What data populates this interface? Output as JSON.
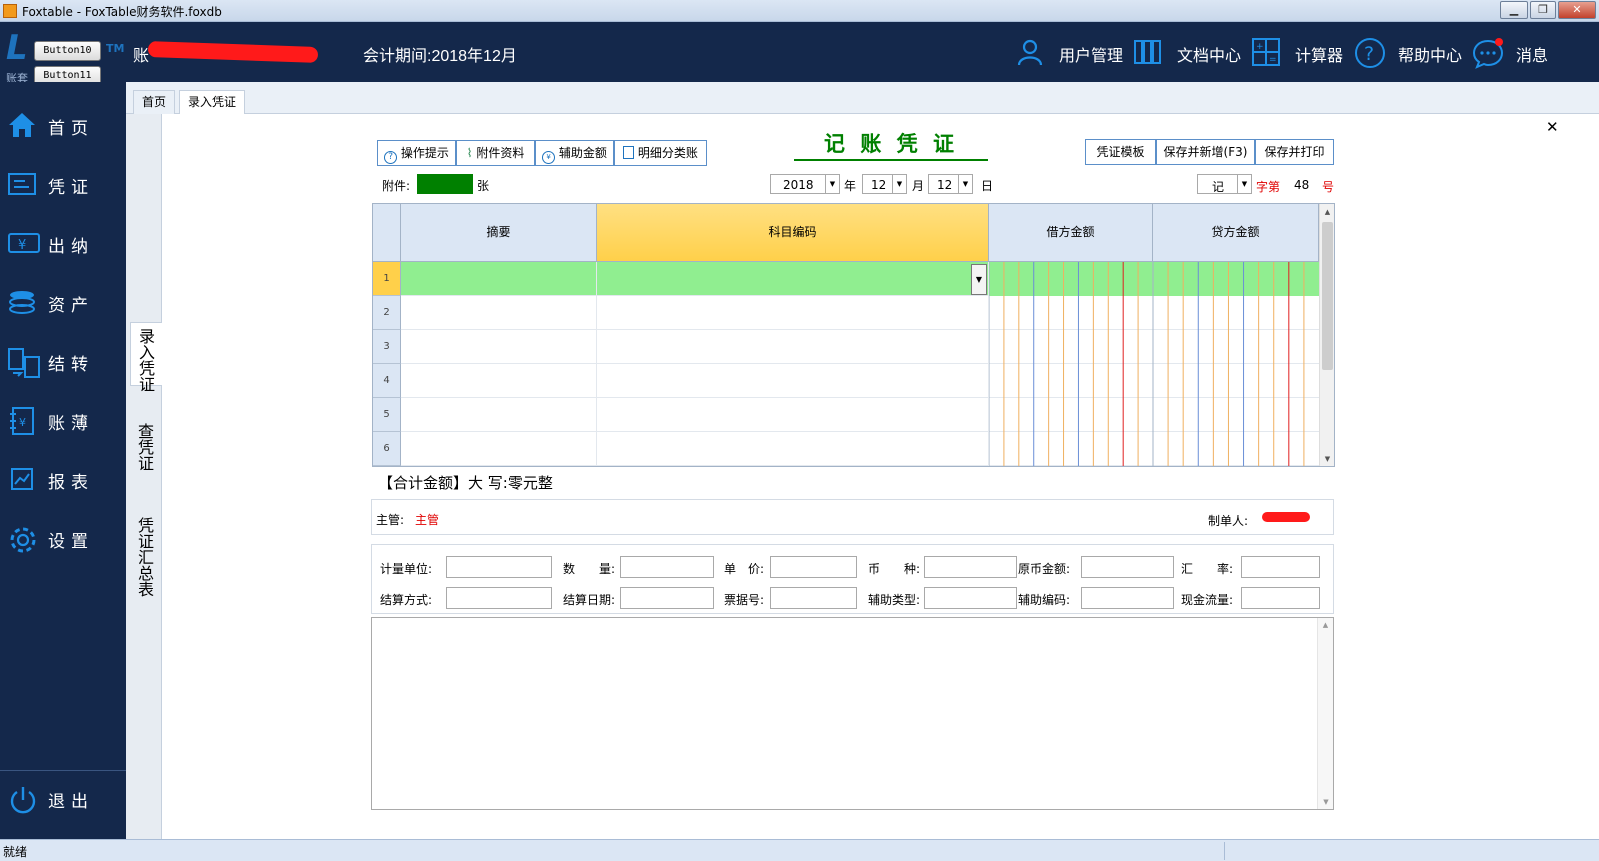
{
  "window": {
    "title": "Foxtable - FoxTable财务软件.foxdb",
    "min": "▁",
    "max": "❐",
    "close": "✕"
  },
  "header": {
    "logo": "L",
    "logo_sub": "账套",
    "tm": "TM",
    "button10": "Button10",
    "button11": "Button11",
    "account_prefix": "账",
    "period": "会计期间:2018年12月",
    "nav": [
      {
        "label": "用户管理",
        "icon": "user-icon"
      },
      {
        "label": "文档中心",
        "icon": "books-icon"
      },
      {
        "label": "计算器",
        "icon": "calculator-icon"
      },
      {
        "label": "帮助中心",
        "icon": "help-icon"
      },
      {
        "label": "消息",
        "icon": "chat-icon"
      }
    ]
  },
  "sidebar": {
    "items": [
      {
        "label": "首页",
        "icon": "home-icon"
      },
      {
        "label": "凭证",
        "icon": "voucher-icon"
      },
      {
        "label": "出纳",
        "icon": "cashier-icon"
      },
      {
        "label": "资产",
        "icon": "coins-icon"
      },
      {
        "label": "结转",
        "icon": "transfer-icon"
      },
      {
        "label": "账薄",
        "icon": "ledger-icon"
      },
      {
        "label": "报表",
        "icon": "report-icon"
      },
      {
        "label": "设置",
        "icon": "gear-icon"
      }
    ],
    "exit": "退出"
  },
  "tabs": [
    {
      "label": "首页"
    },
    {
      "label": "录入凭证"
    }
  ],
  "vtabs": [
    {
      "label": "录入凭证"
    },
    {
      "label": "查凭证"
    },
    {
      "label": "凭证汇总表"
    }
  ],
  "close_icon": "✕",
  "voucher": {
    "title": "记 账 凭 证",
    "toolbar": {
      "tips": "操作提示",
      "attach": "附件资料",
      "assist": "辅助金额",
      "detail": "明细分类账"
    },
    "actions": {
      "template": "凭证模板",
      "save_new": "保存并新增(F3)",
      "save_print": "保存并打印"
    },
    "attach_label": "附件:",
    "attach_unit": "张",
    "date": {
      "year": "2018",
      "year_label": "年",
      "month": "12",
      "month_label": "月",
      "day": "12",
      "day_label": "日"
    },
    "word": "记",
    "zi_di": "字第",
    "number": "48",
    "hao": "号",
    "columns": {
      "summary": "摘要",
      "subject": "科目编码",
      "debit": "借方金额",
      "credit": "贷方金额"
    },
    "rows": [
      "1",
      "2",
      "3",
      "4",
      "5",
      "6"
    ],
    "total": "【合计金额】大 写:零元整",
    "supervisor_label": "主管:",
    "supervisor_value": "主管",
    "maker_label": "制单人:",
    "fields_row1": [
      {
        "label": "计量单位:"
      },
      {
        "label": "数　　量:"
      },
      {
        "label": "单　价:"
      },
      {
        "label": "币　　种:"
      },
      {
        "label": "原币金额:"
      },
      {
        "label": "汇　　率:"
      }
    ],
    "fields_row2": [
      {
        "label": "结算方式:"
      },
      {
        "label": "结算日期:"
      },
      {
        "label": "票据号:"
      },
      {
        "label": "辅助类型:"
      },
      {
        "label": "辅助编码:"
      },
      {
        "label": "现金流量:"
      }
    ]
  },
  "status": {
    "text": "就绪"
  },
  "colors": {
    "header": "#14284b",
    "accent": "#1e73be",
    "green": "#008000",
    "row_green": "#90ee90",
    "subject_header": "#ffd75a"
  }
}
